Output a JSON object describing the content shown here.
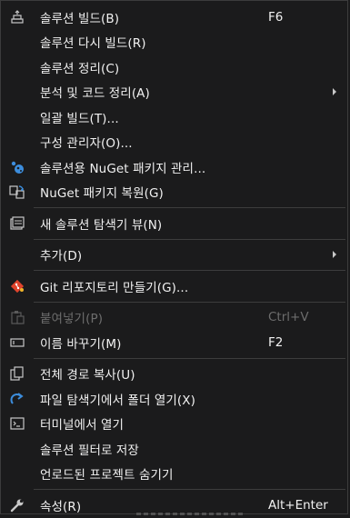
{
  "menu": {
    "items": [
      {
        "label": "솔루션 빌드(B)",
        "shortcut": "F6",
        "icon": "build-solution-icon"
      },
      {
        "label": "솔루션 다시 빌드(R)"
      },
      {
        "label": "솔루션 정리(C)"
      },
      {
        "label": "분석 및 코드 정리(A)",
        "submenu": true
      },
      {
        "label": "일괄 빌드(T)..."
      },
      {
        "label": "구성 관리자(O)..."
      },
      {
        "label": "솔루션용 NuGet 패키지 관리...",
        "icon": "nuget-icon"
      },
      {
        "label": "NuGet 패키지 복원(G)",
        "icon": "restore-packages-icon"
      },
      {
        "label": "새 솔루션 탐색기 뷰(N)",
        "icon": "new-view-icon"
      },
      {
        "label": "추가(D)",
        "submenu": true
      },
      {
        "label": "Git 리포지토리 만들기(G)...",
        "icon": "git-icon"
      },
      {
        "label": "붙여넣기(P)",
        "shortcut": "Ctrl+V",
        "disabled": true,
        "icon": "paste-icon"
      },
      {
        "label": "이름 바꾸기(M)",
        "shortcut": "F2",
        "icon": "rename-icon"
      },
      {
        "label": "전체 경로 복사(U)",
        "icon": "copy-icon"
      },
      {
        "label": "파일 탐색기에서 폴더 열기(X)",
        "icon": "open-folder-icon"
      },
      {
        "label": "터미널에서 열기",
        "icon": "terminal-icon"
      },
      {
        "label": "솔루션 필터로 저장"
      },
      {
        "label": "언로드된 프로젝트 숨기기"
      },
      {
        "label": "속성(R)",
        "shortcut": "Alt+Enter",
        "icon": "wrench-icon"
      }
    ]
  },
  "colors": {
    "background": "#1b1b1c",
    "text": "#f1f1f1",
    "disabled_text": "#6d6d6d",
    "separator": "#3d3d3d",
    "nuget_blue": "#3c8ddc",
    "git_red": "#e0442c"
  }
}
